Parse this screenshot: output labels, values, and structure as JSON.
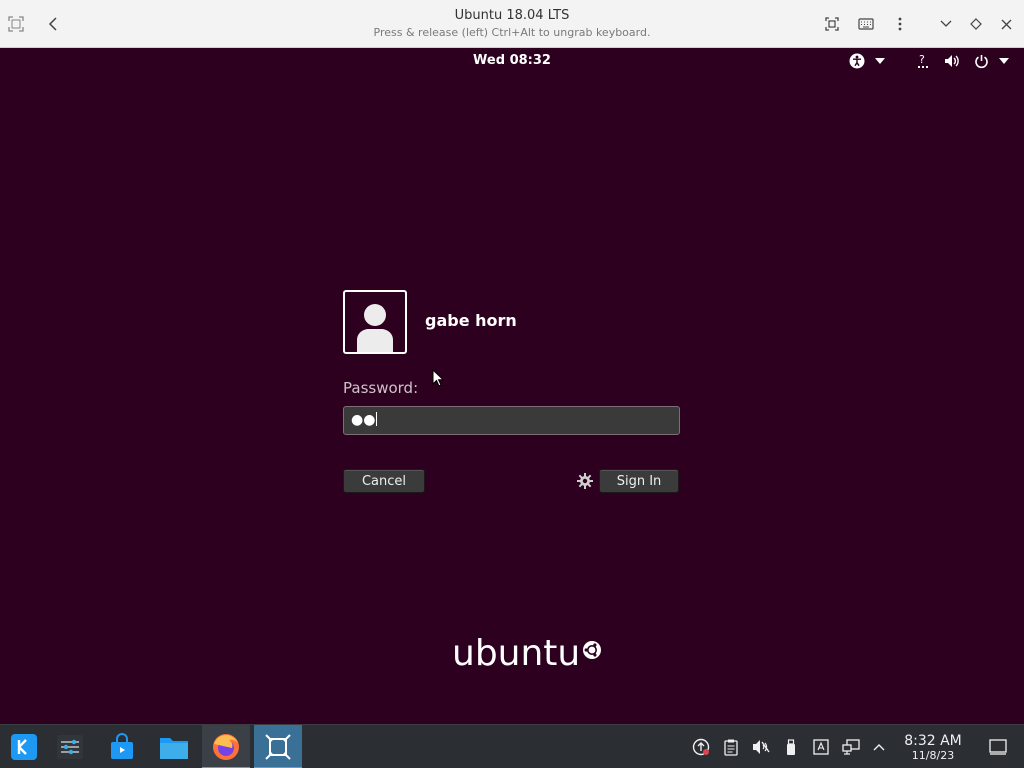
{
  "vm_window": {
    "title": "Ubuntu 18.04 LTS",
    "subtitle": "Press & release (left) Ctrl+Alt to ungrab keyboard."
  },
  "guest_topbar": {
    "clock": "Wed 08:32"
  },
  "login": {
    "username": "gabe horn",
    "password_label": "Password:",
    "password_mask": "●●",
    "cancel_label": "Cancel",
    "signin_label": "Sign In"
  },
  "branding": {
    "logo_text": "ubuntu"
  },
  "taskbar": {
    "time": "8:32 AM",
    "date": "11/8/23",
    "accent_color": "#3daee9"
  },
  "colors": {
    "guest_background": "#2c001e",
    "taskbar_background": "#2b2e33"
  }
}
